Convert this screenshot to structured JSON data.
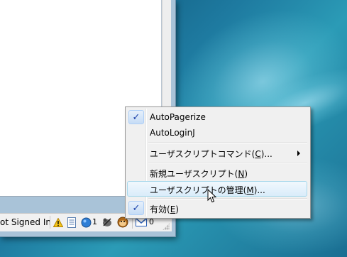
{
  "status_bar": {
    "text": "ot Signed In",
    "icons": [
      {
        "name": "warning-icon",
        "glyph": "⚠"
      },
      {
        "name": "document-icon",
        "glyph": "📄"
      },
      {
        "name": "chat-icon",
        "glyph": ""
      },
      {
        "name": "greasemonkey-icon",
        "glyph": ""
      },
      {
        "name": "monkey-face-icon",
        "glyph": ""
      },
      {
        "name": "mail-icon",
        "glyph": "M"
      }
    ],
    "chat_count": "1",
    "mail_count": "0"
  },
  "menu": {
    "items": [
      {
        "label": "AutoPagerize",
        "checked": true
      },
      {
        "label": "AutoLoginJ",
        "checked": false
      },
      {
        "label": "ユーザスクリプトコマンド(C)...",
        "label_pre": "ユーザスクリプトコマンド(",
        "accel": "C",
        "label_post": ")...",
        "submenu": true
      },
      {
        "label": "新規ユーザスクリプト(N)",
        "label_pre": "新規ユーザスクリプト(",
        "accel": "N",
        "label_post": ")"
      },
      {
        "label": "ユーザスクリプトの管理(M)...",
        "label_pre": "ユーザスクリプトの管理(",
        "accel": "M",
        "label_post": ")...",
        "hovered": true
      },
      {
        "label": "有効(E)",
        "label_pre": "有効(",
        "accel": "E",
        "label_post": ")",
        "checked": true
      }
    ]
  },
  "colors": {
    "check": "#1a3fa8",
    "hover_border": "#a8d8eb",
    "desktop": "#1e7aa0"
  }
}
